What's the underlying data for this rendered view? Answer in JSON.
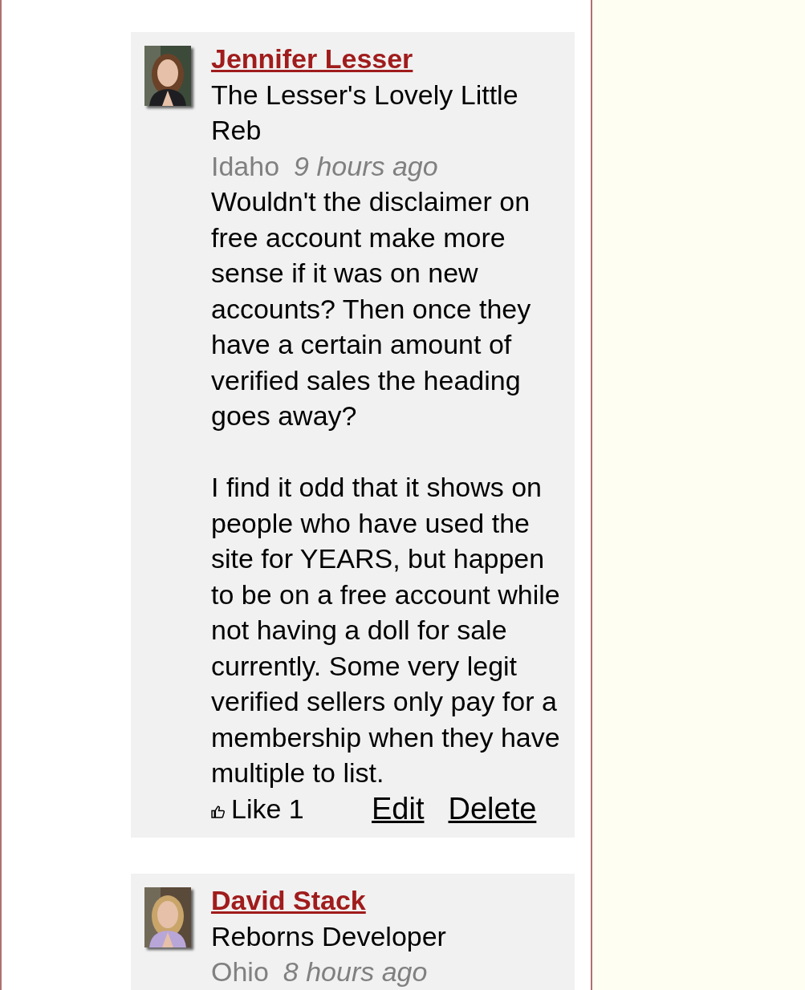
{
  "comments": [
    {
      "author": "Jennifer Lesser",
      "title": "The Lesser's Lovely Little Reb",
      "location": "Idaho",
      "time": "9 hours ago",
      "paragraphs": [
        "Wouldn't the disclaimer on free account make more sense if it was on new accounts? Then once they have a certain amount of verified sales the heading goes away?",
        "I find it odd that it shows on people who have used the site for YEARS, but happen to be on a free account while not having a doll for sale currently. Some very legit verified sellers only pay for a membership when they have multiple to list."
      ],
      "like_label": "Like 1",
      "actions": [
        "Edit",
        "Delete"
      ]
    },
    {
      "author": "David Stack",
      "title": "Reborns Developer",
      "location": "Ohio",
      "time": "8 hours ago"
    }
  ]
}
